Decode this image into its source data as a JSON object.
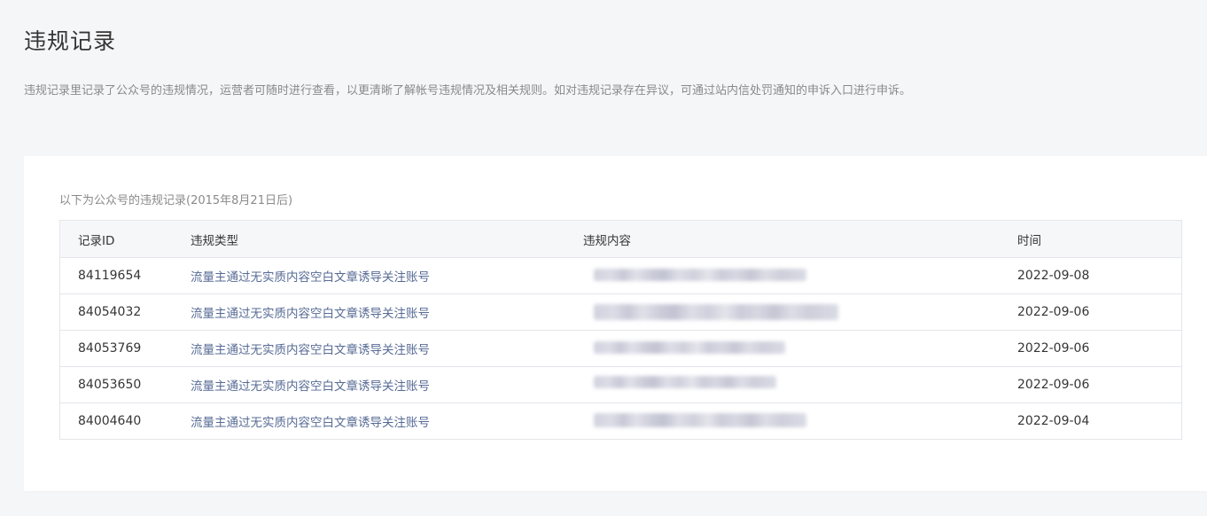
{
  "page": {
    "title": "违规记录",
    "description": "违规记录里记录了公众号的违规情况，运营者可随时进行查看，以更清晰了解帐号违规情况及相关规则。如对违规记录存在异议，可通过站内信处罚通知的申诉入口进行申诉。"
  },
  "table": {
    "caption": "以下为公众号的违规记录(2015年8月21日后)",
    "columns": [
      "记录ID",
      "违规类型",
      "违规内容",
      "时间"
    ],
    "rows": [
      {
        "id": "84119654",
        "type": "流量主通过无实质内容空白文章诱导关注账号",
        "content": "",
        "time": "2022-09-08"
      },
      {
        "id": "84054032",
        "type": "流量主通过无实质内容空白文章诱导关注账号",
        "content": "",
        "time": "2022-09-06"
      },
      {
        "id": "84053769",
        "type": "流量主通过无实质内容空白文章诱导关注账号",
        "content": "",
        "time": "2022-09-06"
      },
      {
        "id": "84053650",
        "type": "流量主通过无实质内容空白文章诱导关注账号",
        "content": "",
        "time": "2022-09-06"
      },
      {
        "id": "84004640",
        "type": "流量主通过无实质内容空白文章诱导关注账号",
        "content": "",
        "time": "2022-09-04"
      }
    ]
  },
  "colors": {
    "background": "#f5f6f8",
    "card": "#ffffff",
    "link": "#576b95",
    "muted_text": "#8a8a8a",
    "border": "#e4e6eb",
    "header_bg": "#f6f7f9"
  }
}
